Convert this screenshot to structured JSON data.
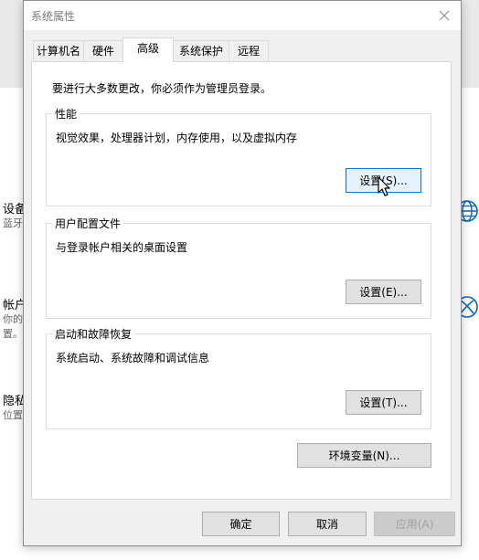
{
  "background": {
    "items": [
      {
        "title": "设备",
        "subtitle": "蓝牙"
      },
      {
        "title": "帐户",
        "subtitle": "你的",
        "subtitle2": "置。"
      },
      {
        "title": "隐私",
        "subtitle": "位置"
      }
    ]
  },
  "dialog": {
    "title": "系统属性",
    "tabs": [
      {
        "label": "计算机名"
      },
      {
        "label": "硬件"
      },
      {
        "label": "高级"
      },
      {
        "label": "系统保护"
      },
      {
        "label": "远程"
      }
    ],
    "active_tab": "高级",
    "notice": "要进行大多数更改，你必须作为管理员登录。",
    "groups": {
      "performance": {
        "title": "性能",
        "description": "视觉效果，处理器计划，内存使用，以及虚拟内存",
        "button": "设置(S)..."
      },
      "user_profiles": {
        "title": "用户配置文件",
        "description": "与登录帐户相关的桌面设置",
        "button": "设置(E)..."
      },
      "startup_recovery": {
        "title": "启动和故障恢复",
        "description": "系统启动、系统故障和调试信息",
        "button": "设置(T)..."
      }
    },
    "env_button": "环境变量(N)...",
    "footer": {
      "ok": "确定",
      "cancel": "取消",
      "apply": "应用(A)"
    }
  },
  "colors": {
    "focus_border": "#0078d7",
    "globe_icon": "#0067c0"
  }
}
